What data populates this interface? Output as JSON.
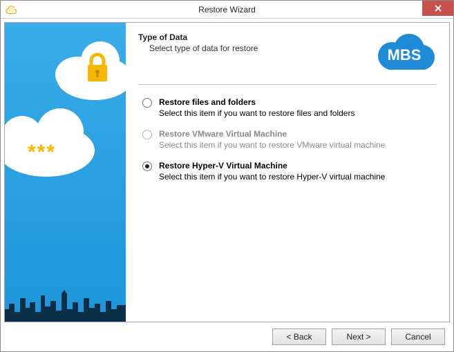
{
  "window": {
    "title": "Restore Wizard"
  },
  "logo": {
    "text": "MBS"
  },
  "header": {
    "title": "Type of Data",
    "subtitle": "Select type of data for restore"
  },
  "options": [
    {
      "title": "Restore files and folders",
      "desc": "Select this item if you want to restore files and folders",
      "selected": false,
      "enabled": true
    },
    {
      "title": "Restore VMware Virtual Machine",
      "desc": "Select this item if you want to restore VMware virtual machine",
      "selected": false,
      "enabled": false
    },
    {
      "title": "Restore Hyper-V Virtual Machine",
      "desc": "Select this item if you want to restore Hyper-V virtual machine",
      "selected": true,
      "enabled": true
    }
  ],
  "buttons": {
    "back": "< Back",
    "next": "Next >",
    "cancel": "Cancel"
  }
}
